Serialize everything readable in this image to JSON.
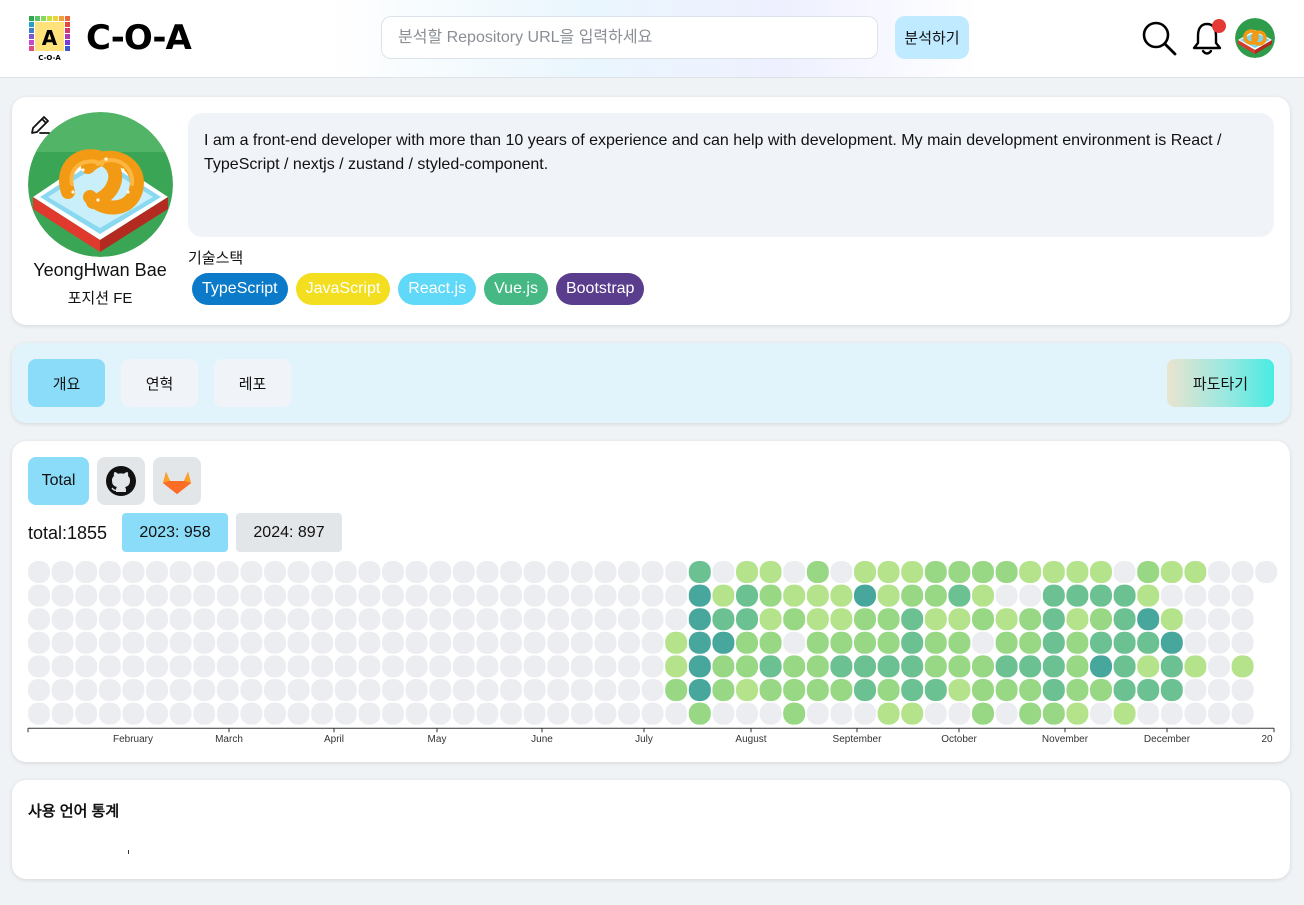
{
  "header": {
    "logo_text": "C-O-A",
    "search_placeholder": "분석할 Repository URL을 입력하세요",
    "analyze_label": "분석하기",
    "icons": [
      "search-icon",
      "bell-icon",
      "avatar"
    ],
    "notification_dot_color": "#e53935"
  },
  "profile": {
    "name": "YeongHwan Bae",
    "position": "포지션 FE",
    "bio": "I am a front-end developer with more than 10 years of experience and can help with development. My main development environment is React / TypeScript / nextjs / zustand / styled-component.",
    "stack_label": "기술스택",
    "stack": [
      {
        "label": "TypeScript",
        "color": "#0b7bc9"
      },
      {
        "label": "JavaScript",
        "color": "#f3de20"
      },
      {
        "label": "React.js",
        "color": "#60d8f8"
      },
      {
        "label": "Vue.js",
        "color": "#45b884"
      },
      {
        "label": "Bootstrap",
        "color": "#5a3d8c"
      }
    ]
  },
  "tabs": {
    "items": [
      "개요",
      "연혁",
      "레포"
    ],
    "active": 0,
    "surf_label": "파도타기"
  },
  "contributions": {
    "sources": [
      "Total",
      "github-icon",
      "gitlab-icon"
    ],
    "source_label": "Total",
    "total_label": "total:1855",
    "years": [
      "2023: 958",
      "2024: 897"
    ],
    "active_year": "2023: 958",
    "colors": {
      "empty": "#ebedf0",
      "level1": "#b4e38c",
      "level2": "#98d885",
      "level3": "#6cc193",
      "level4": "#47a79c"
    },
    "month_labels": [
      "February",
      "March",
      "April",
      "May",
      "June",
      "July",
      "August",
      "September",
      "October",
      "November",
      "December",
      "20"
    ]
  },
  "languages": {
    "title": "사용 언어 통계"
  }
}
